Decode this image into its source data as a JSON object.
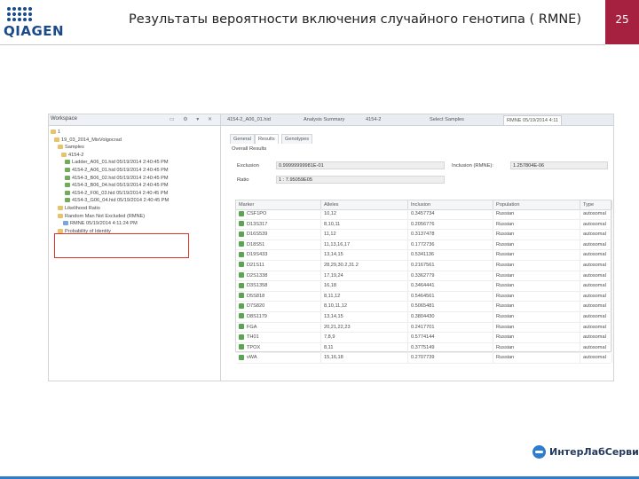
{
  "slide": {
    "title": "Результаты вероятности включения случайного генотипа ( RMNE)",
    "page_number": "25",
    "logo_text": "QIAGEN",
    "footer_brand": "ИнтерЛабСервис"
  },
  "left_panel": {
    "tab_label": "Workspace",
    "tree": [
      {
        "label": "1",
        "icon": "folder"
      },
      {
        "label": "19_03_2014_MixVolgocrad",
        "icon": "folder"
      },
      {
        "label": "Samples",
        "icon": "folder"
      },
      {
        "label": "4154-2",
        "icon": "folder"
      },
      {
        "label": "Ladder_A06_01.hid 05/19/2014 2:40:45 PM",
        "icon": "chart"
      },
      {
        "label": "4154-2_A06_01.hid 05/19/2014 2:40:45 PM",
        "icon": "chart"
      },
      {
        "label": "4154-3_B06_02.hid 05/19/2014 2:40:45 PM",
        "icon": "chart"
      },
      {
        "label": "4154-3_B06_04.hid 05/19/2014 2:40:45 PM",
        "icon": "chart"
      },
      {
        "label": "4154-2_F06_03.hid 05/19/2014 2:40:45 PM",
        "icon": "chart"
      },
      {
        "label": "4154-3_G06_04.hid 05/19/2014 2:40:45 PM",
        "icon": "chart"
      },
      {
        "label": "Likelihood Ratio",
        "icon": "folder"
      },
      {
        "label": "Random Man Not Excluded (RMNE)",
        "icon": "folder"
      },
      {
        "label": "RMNE 05/19/2014 4:11:24 PM",
        "icon": "file"
      },
      {
        "label": "Probability of Identity",
        "icon": "folder"
      }
    ]
  },
  "editor": {
    "tabs": [
      {
        "label": "4154-2_A06_01.hid",
        "active": false
      },
      {
        "label": "Analysis Summary",
        "active": false
      },
      {
        "label": "4154-2",
        "active": false
      },
      {
        "label": "Select Samples",
        "active": false
      },
      {
        "label": "RMNE 05/19/2014 4:11",
        "active": true
      }
    ],
    "subtabs": [
      {
        "label": "General",
        "active": false
      },
      {
        "label": "Results",
        "active": true
      },
      {
        "label": "Genotypes",
        "active": false
      }
    ],
    "results_header": "Overall Results",
    "exclusion_label": "Exclusion",
    "exclusion_value": "0.99999999981E-01",
    "inclusion_label": "Inclusion (RMNE):",
    "inclusion_value": "1.257804E-06",
    "ratio_label": "Ratio",
    "ratio_value": "1 : 7.95059E05",
    "columns": [
      "Marker",
      "Alleles",
      "Inclusion",
      "Population",
      "Type"
    ],
    "rows": [
      [
        "CSF1PO",
        "10,12",
        "0.3457734",
        "Russian",
        "autosomal"
      ],
      [
        "D13S317",
        "8,10,11",
        "0.2056776",
        "Russian",
        "autosomal"
      ],
      [
        "D16S539",
        "11,12",
        "0.3137478",
        "Russian",
        "autosomal"
      ],
      [
        "D18S51",
        "11,13,16,17",
        "0.1772736",
        "Russian",
        "autosomal"
      ],
      [
        "D19S433",
        "13,14,15",
        "0.5341136",
        "Russian",
        "autosomal"
      ],
      [
        "D21S11",
        "28,29,30.2,31.2",
        "0.2167561",
        "Russian",
        "autosomal"
      ],
      [
        "D2S1338",
        "17,19,24",
        "0.3362779",
        "Russian",
        "autosomal"
      ],
      [
        "D3S1358",
        "16,18",
        "0.3464441",
        "Russian",
        "autosomal"
      ],
      [
        "D5S818",
        "8,11,12",
        "0.5464561",
        "Russian",
        "autosomal"
      ],
      [
        "D7S820",
        "8,10,11,12",
        "0.5065481",
        "Russian",
        "autosomal"
      ],
      [
        "D8S1179",
        "13,14,15",
        "0.3804430",
        "Russian",
        "autosomal"
      ],
      [
        "FGA",
        "20,21,22,23",
        "0.2417701",
        "Russian",
        "autosomal"
      ],
      [
        "TH01",
        "7,8,9",
        "0.5774144",
        "Russian",
        "autosomal"
      ],
      [
        "TPOX",
        "8,11",
        "0.3775149",
        "Russian",
        "autosomal"
      ],
      [
        "vWA",
        "15,16,18",
        "0.2707739",
        "Russian",
        "autosomal"
      ]
    ]
  },
  "colors": {
    "accent": "#a6213f",
    "highlight": "#e0332b",
    "footer_accent": "#2e7ccc"
  }
}
